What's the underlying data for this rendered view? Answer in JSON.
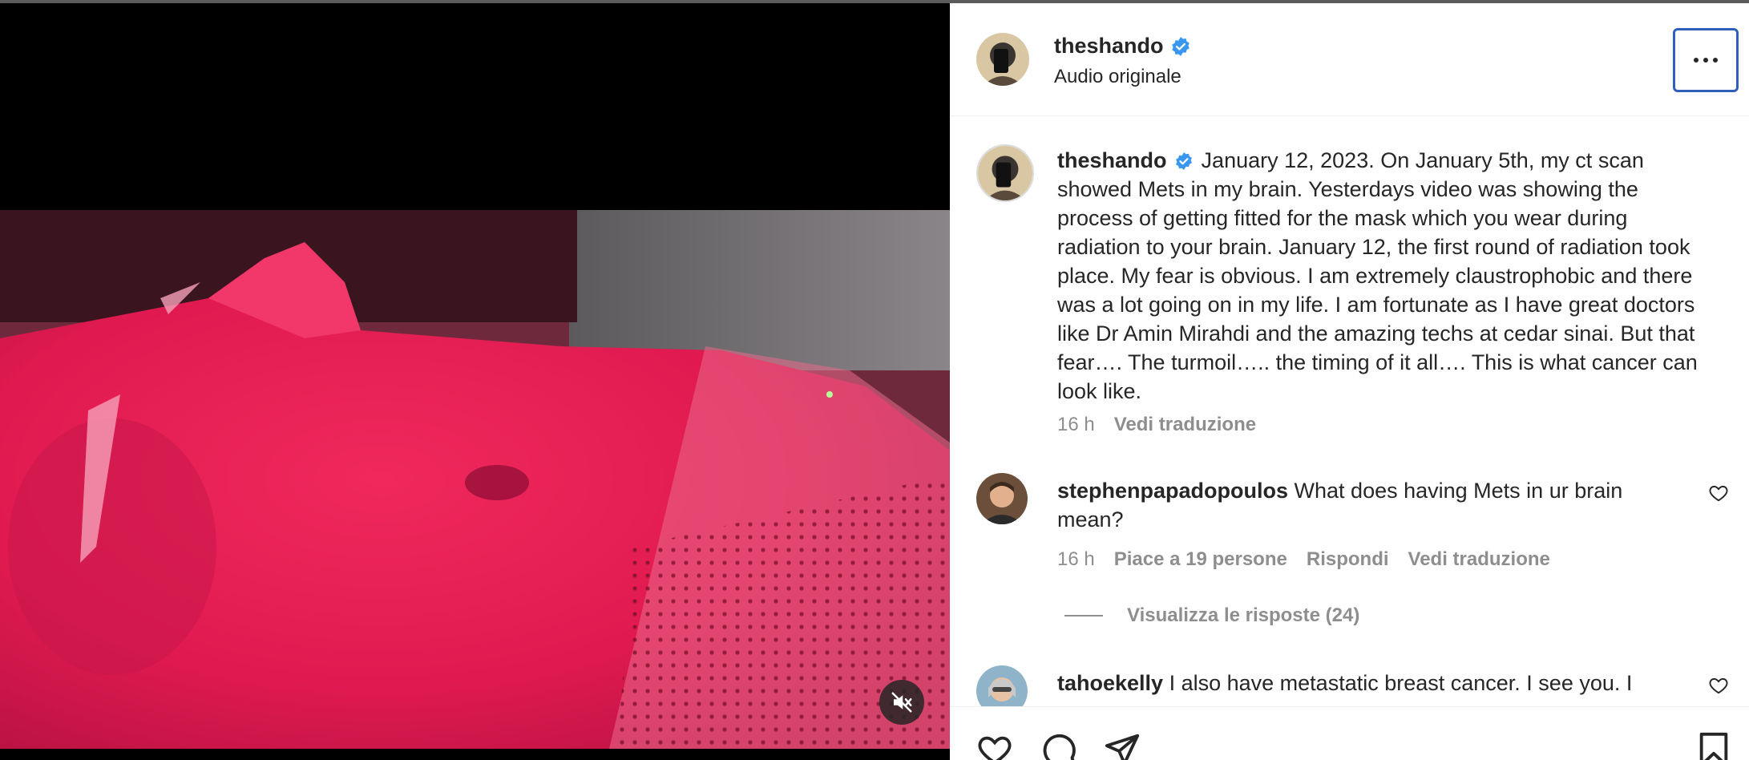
{
  "post": {
    "username": "theshando",
    "audio": "Audio originale"
  },
  "caption": {
    "username": "theshando",
    "text": "January 12, 2023. On January 5th, my ct scan showed Mets in my brain. Yesterdays video was showing the process of getting fitted for the mask which you wear during radiation to your brain. January 12, the first round of radiation took place. My fear is obvious. I am extremely claustrophobic and there was a lot going on in my life. I am fortunate as I have great doctors like Dr Amin Mirahdi and the amazing techs at cedar sinai. But that fear…. The turmoil….. the timing of it all…. This is what cancer can look like.",
    "time": "16 h",
    "translate": "Vedi traduzione"
  },
  "comments": [
    {
      "username": "stephenpapadopoulos",
      "text": "What does having Mets in ur brain mean?",
      "time": "16 h",
      "likes": "Piace a 19 persone",
      "reply": "Rispondi",
      "translate": "Vedi traduzione",
      "view_replies": "Visualizza le risposte (24)"
    },
    {
      "username": "tahoekelly",
      "text": "I also have metastatic breast cancer. I see you. I"
    }
  ],
  "icons": {
    "verified": "verified-badge-icon",
    "more": "more-options-icon",
    "mute": "muted-speaker-icon",
    "like": "heart-icon",
    "comment": "comment-icon",
    "share": "share-icon",
    "save": "bookmark-icon"
  },
  "colors": {
    "verified": "#3897f0",
    "focus_ring": "#2f5fb9",
    "secondary_text": "#8e8e8e",
    "media_tint": "#e5194f"
  }
}
